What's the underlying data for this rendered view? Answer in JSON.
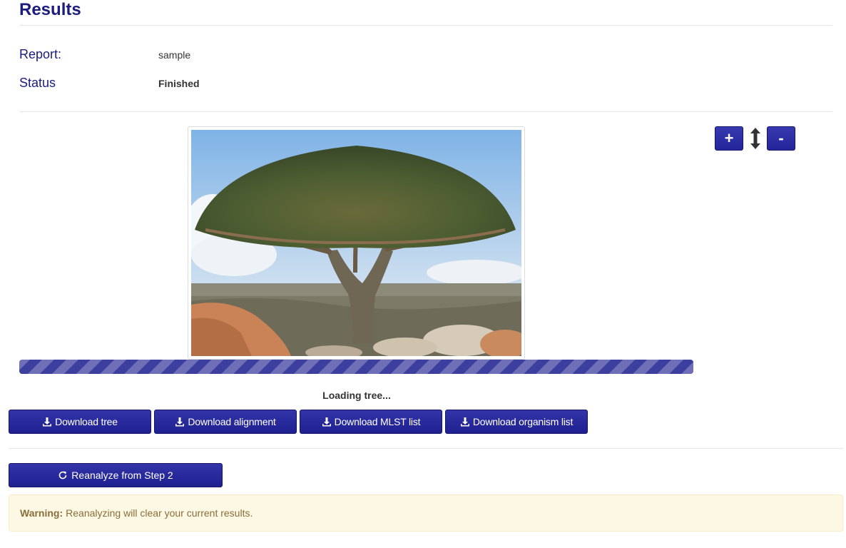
{
  "header": {
    "title": "Results"
  },
  "fields": {
    "report_label": "Report:",
    "report_value": "sample",
    "status_label": "Status",
    "status_value": "Finished"
  },
  "viewer": {
    "zoom_in_label": "+",
    "zoom_out_label": "-",
    "progress_percent": 100,
    "loading_text": "Loading tree..."
  },
  "downloads": {
    "tree": "Download tree",
    "alignment": "Download alignment",
    "mlst": "Download MLST list",
    "organism": "Download organism list"
  },
  "actions": {
    "reanalyze": "Reanalyze from Step 2"
  },
  "warning": {
    "title": "Warning:",
    "message": "Reanalyzing will clear your current results."
  },
  "colors": {
    "primary": "#2a2ca0",
    "heading": "#1b1c7e",
    "warning_bg": "#fcf8e3",
    "warning_text": "#8a6d3b"
  }
}
